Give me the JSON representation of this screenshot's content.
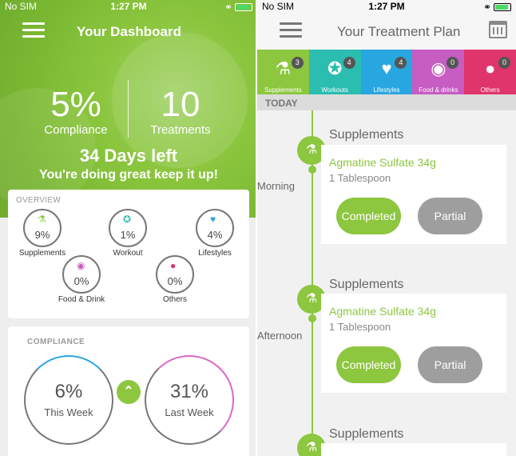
{
  "status_left": {
    "carrier": "No SIM",
    "time": "1:27 PM"
  },
  "status_right": {
    "carrier": "No SIM",
    "time": "1:27 PM"
  },
  "dashboard": {
    "title": "Your Dashboard",
    "compliance_value": "5%",
    "compliance_label": "Compliance",
    "treatments_value": "10",
    "treatments_label": "Treatments",
    "days_left": "34 Days left",
    "encouragement": "You're doing great keep it up!",
    "overview": {
      "title": "OVERVIEW",
      "categories": [
        {
          "name": "Supplements",
          "value": "9%",
          "icon": "supplements-icon",
          "color": "#8dc63f"
        },
        {
          "name": "Workout",
          "value": "1%",
          "icon": "workout-icon",
          "color": "#2bbdb0"
        },
        {
          "name": "Lifestyles",
          "value": "4%",
          "icon": "heartbeat-icon",
          "color": "#28a6e0"
        },
        {
          "name": "Food & Drink",
          "value": "0%",
          "icon": "food-drink-icon",
          "color": "#c75cc2"
        },
        {
          "name": "Others",
          "value": "0%",
          "icon": "others-icon",
          "color": "#e0356a"
        }
      ]
    },
    "compliance_card": {
      "title": "COMPLIANCE",
      "this_week_value": "6%",
      "this_week_label": "This Week",
      "last_week_value": "31%",
      "last_week_label": "Last Week"
    }
  },
  "plan": {
    "title": "Your Treatment Plan",
    "tabs": [
      {
        "label": "Supplements",
        "count": "3",
        "color": "#8dc63f",
        "icon": "supplements-icon"
      },
      {
        "label": "Workouts",
        "count": "4",
        "color": "#2bbdb0",
        "icon": "workout-icon"
      },
      {
        "label": "Lifestyles",
        "count": "4",
        "color": "#28a6e0",
        "icon": "heartbeat-icon"
      },
      {
        "label": "Food & drinks",
        "count": "0",
        "color": "#c75cc2",
        "icon": "food-drink-icon"
      },
      {
        "label": "Others",
        "count": "0",
        "color": "#e0356a",
        "icon": "others-icon"
      }
    ],
    "today_label": "TODAY",
    "slots": [
      {
        "time": "Morning",
        "category": "Supplements",
        "medication": "Agmatine Sulfate 34g",
        "dose": "1 Tablespoon",
        "completed_label": "Completed",
        "partial_label": "Partial"
      },
      {
        "time": "Afternoon",
        "category": "Supplements",
        "medication": "Agmatine Sulfate 34g",
        "dose": "1 Tablespoon",
        "completed_label": "Completed",
        "partial_label": "Partial"
      },
      {
        "time": "",
        "category": "Supplements"
      }
    ]
  }
}
